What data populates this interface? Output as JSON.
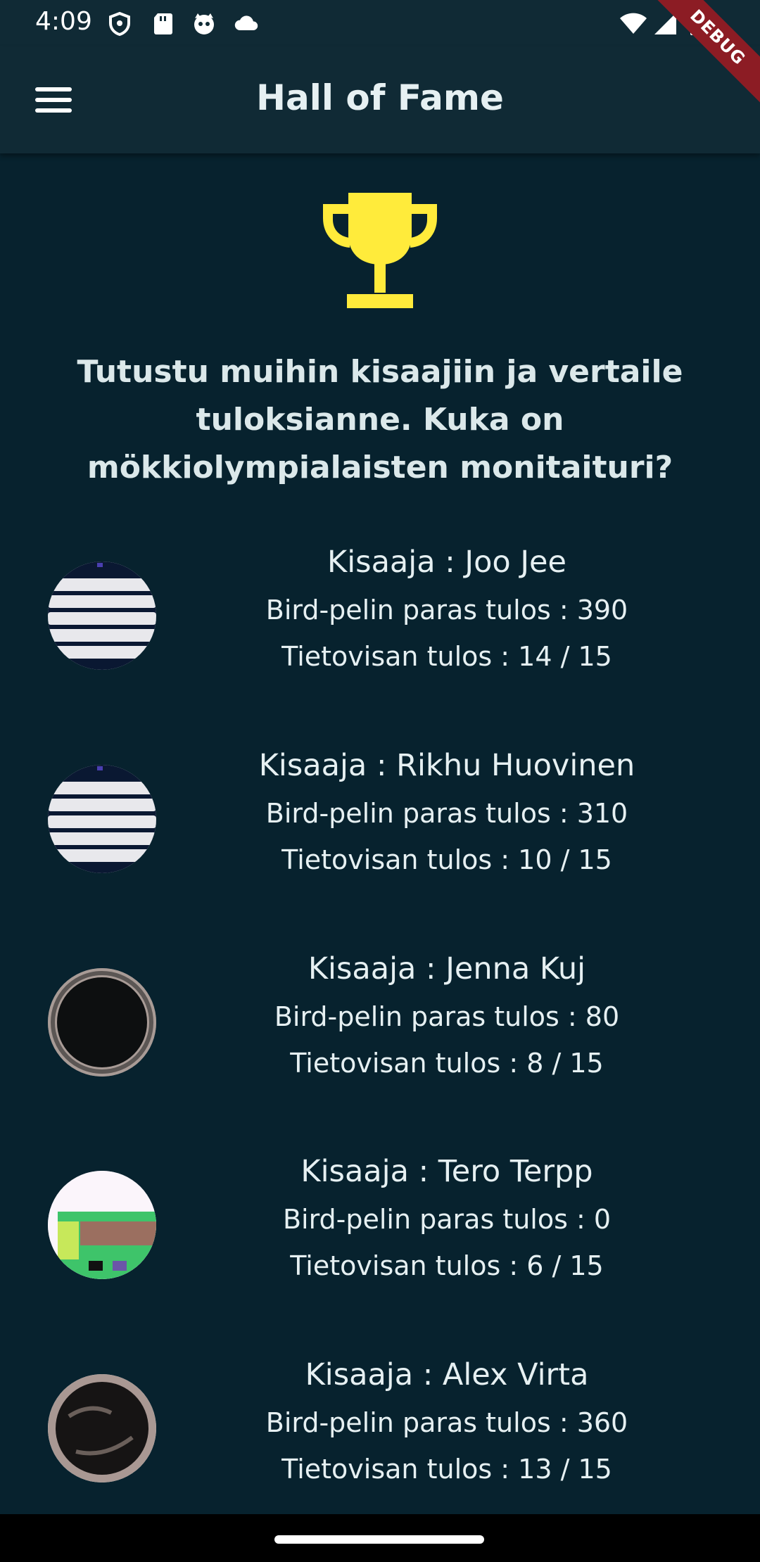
{
  "status_bar": {
    "time": "4:09",
    "icons_left": [
      "shield-icon",
      "sd-card-icon",
      "cat-icon",
      "cloud-icon"
    ],
    "icons_right": [
      "wifi-icon",
      "signal-icon",
      "battery-icon"
    ]
  },
  "app_bar": {
    "title": "Hall of Fame",
    "menu_icon": "menu-icon"
  },
  "debug_banner": "DEBUG",
  "trophy": {
    "icon": "trophy-icon",
    "color": "#ffeb3b"
  },
  "intro_text": "Tutustu muihin kisaajiin ja vertaile tuloksianne. Kuka on mökkiolympialaisten monitaituri?",
  "players": [
    {
      "name": "Kisaaja : Joo Jee",
      "bird": "Bird-pelin paras tulos : 390",
      "quiz": "Tietovisan tulos : 14 / 15"
    },
    {
      "name": "Kisaaja : Rikhu Huovinen",
      "bird": "Bird-pelin paras tulos : 310",
      "quiz": "Tietovisan tulos : 10 / 15"
    },
    {
      "name": "Kisaaja : Jenna Kuj",
      "bird": "Bird-pelin paras tulos : 80",
      "quiz": "Tietovisan tulos : 8 / 15"
    },
    {
      "name": "Kisaaja : Tero Terpp",
      "bird": "Bird-pelin paras tulos : 0",
      "quiz": "Tietovisan tulos : 6 / 15"
    },
    {
      "name": "Kisaaja : Alex Virta",
      "bird": "Bird-pelin paras tulos : 360",
      "quiz": "Tietovisan tulos : 13 / 15"
    }
  ],
  "colors": {
    "background": "#07222e",
    "app_bar": "#102a35",
    "text": "#e6f0f2",
    "trophy": "#ffeb3b",
    "debug": "#8c1c24"
  }
}
